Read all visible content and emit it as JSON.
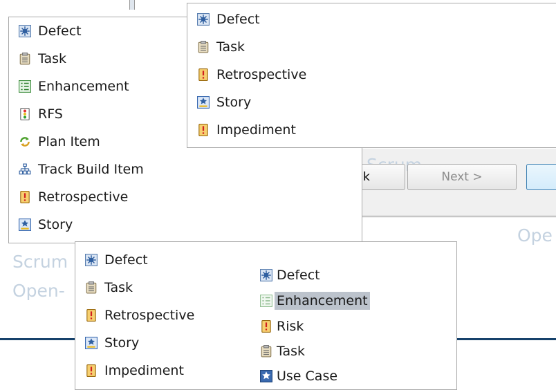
{
  "menu_a": {
    "items": [
      {
        "icon": "defect-icon",
        "label": "Defect"
      },
      {
        "icon": "task-icon",
        "label": "Task"
      },
      {
        "icon": "enhancement-icon",
        "label": "Enhancement"
      },
      {
        "icon": "rfs-icon",
        "label": "RFS"
      },
      {
        "icon": "plan-item-icon",
        "label": "Plan Item"
      },
      {
        "icon": "track-build-item-icon",
        "label": "Track Build Item"
      },
      {
        "icon": "retrospective-icon",
        "label": "Retrospective"
      },
      {
        "icon": "story-icon",
        "label": "Story"
      }
    ]
  },
  "menu_b": {
    "items": [
      {
        "icon": "defect-icon",
        "label": "Defect"
      },
      {
        "icon": "task-icon",
        "label": "Task"
      },
      {
        "icon": "retrospective-icon",
        "label": "Retrospective"
      },
      {
        "icon": "story-icon",
        "label": "Story"
      },
      {
        "icon": "impediment-icon",
        "label": "Impediment"
      }
    ]
  },
  "menu_c": {
    "items": [
      {
        "icon": "defect-icon",
        "label": "Defect"
      },
      {
        "icon": "task-icon",
        "label": "Task"
      },
      {
        "icon": "retrospective-icon",
        "label": "Retrospective"
      },
      {
        "icon": "story-icon",
        "label": "Story"
      },
      {
        "icon": "impediment-icon",
        "label": "Impediment"
      }
    ]
  },
  "menu_d": {
    "items": [
      {
        "icon": "defect-icon",
        "label": "Defect"
      },
      {
        "icon": "enhancement-icon",
        "label": "Enhancement",
        "selected": true
      },
      {
        "icon": "risk-icon",
        "label": "Risk"
      },
      {
        "icon": "task-icon",
        "label": "Task"
      },
      {
        "icon": "use-case-icon",
        "label": "Use Case"
      }
    ]
  },
  "wizard": {
    "back_label": "k",
    "next_label": "Next >"
  },
  "background": {
    "scrum_center": "Scrum",
    "scrum_left": "Scrum",
    "open_left": "Open-",
    "open_right": "Ope"
  },
  "colors": {
    "selection": "#bcc3cc",
    "menu_border": "#a8a8a8",
    "ghost_text": "#c4d2e0",
    "rule": "#16416b"
  }
}
